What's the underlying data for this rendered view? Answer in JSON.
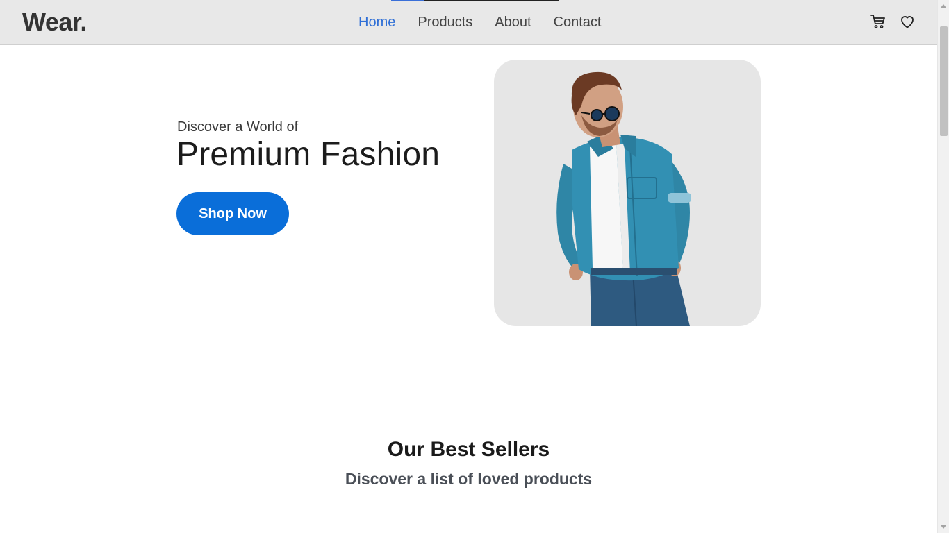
{
  "header": {
    "logo": "Wear.",
    "nav": [
      {
        "label": "Home",
        "active": true
      },
      {
        "label": "Products",
        "active": false
      },
      {
        "label": "About",
        "active": false
      },
      {
        "label": "Contact",
        "active": false
      }
    ],
    "icons": [
      "cart-icon",
      "heart-icon"
    ]
  },
  "hero": {
    "kicker": "Discover a World of",
    "title": "Premium Fashion",
    "cta_label": "Shop Now",
    "image_subject": "model-photo"
  },
  "best_sellers": {
    "title": "Our Best Sellers",
    "subtitle": "Discover a list of loved products"
  },
  "colors": {
    "accent": "#0a6ed9",
    "nav_active": "#2f6fd6",
    "header_bg": "#e8e8e8"
  }
}
